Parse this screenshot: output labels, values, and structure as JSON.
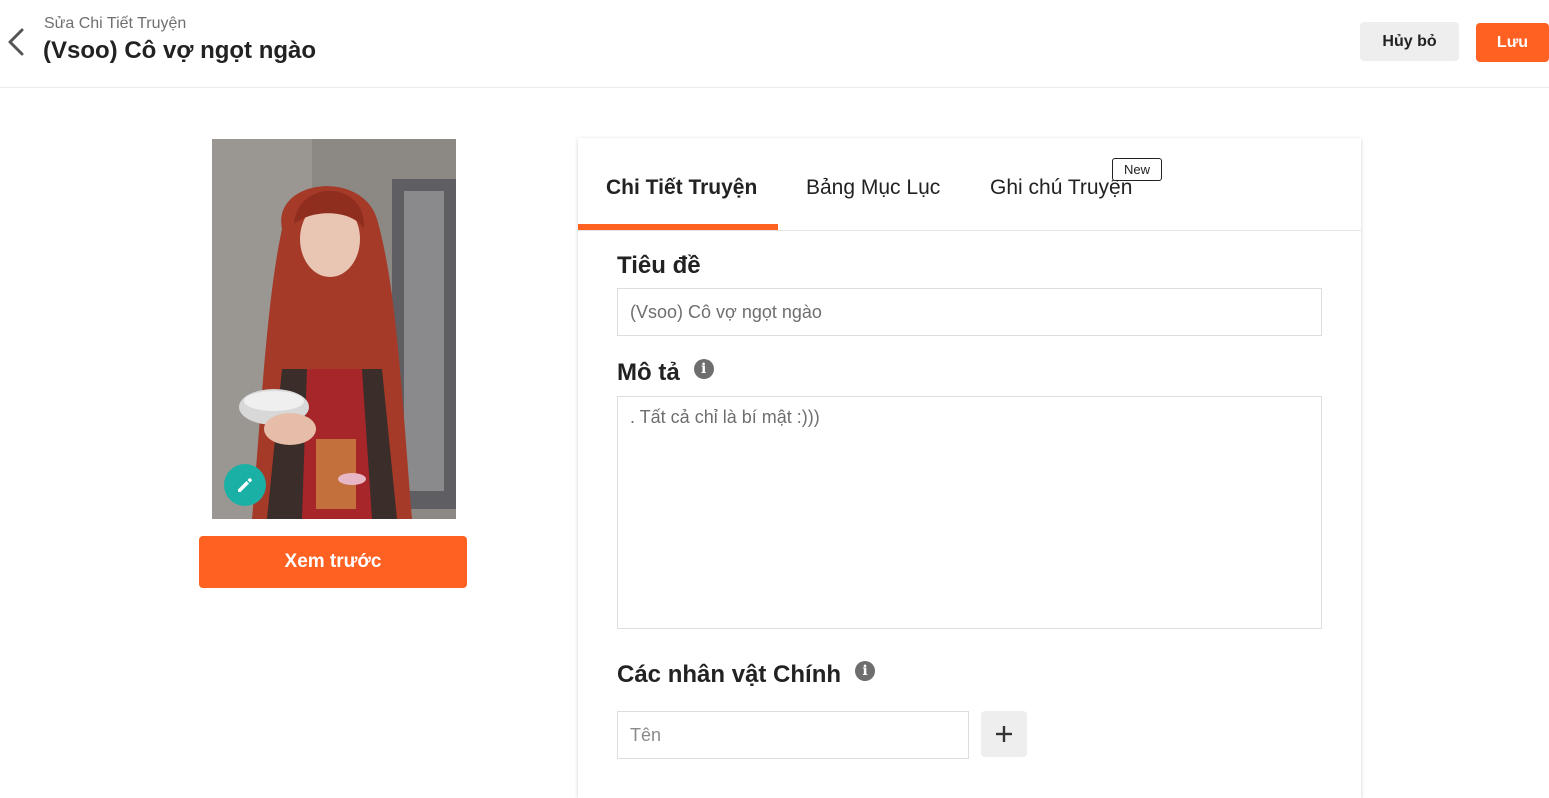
{
  "header": {
    "breadcrumb": "Sửa Chi Tiết Truyện",
    "title": "(Vsoo) Cô vợ ngọt ngào",
    "cancel_label": "Hủy bỏ",
    "save_label": "Lưu"
  },
  "cover": {
    "preview_label": "Xem trước",
    "edit_icon": "pencil-icon"
  },
  "tabs": [
    {
      "label": "Chi Tiết Truyện",
      "active": true
    },
    {
      "label": "Bảng Mục Lục",
      "active": false
    },
    {
      "label": "Ghi chú Truyện",
      "active": false,
      "badge": "New"
    }
  ],
  "form": {
    "title_label": "Tiêu đề",
    "title_value": "(Vsoo) Cô vợ ngọt ngào",
    "description_label": "Mô tả",
    "description_value": ". Tất cả chỉ là bí mật :)))",
    "characters_label": "Các nhân vật Chính",
    "character_placeholder": "Tên",
    "info_icon": "info-icon",
    "add_icon": "plus-icon"
  },
  "colors": {
    "accent": "#ff6122",
    "edit_button": "#1ab0a5"
  }
}
